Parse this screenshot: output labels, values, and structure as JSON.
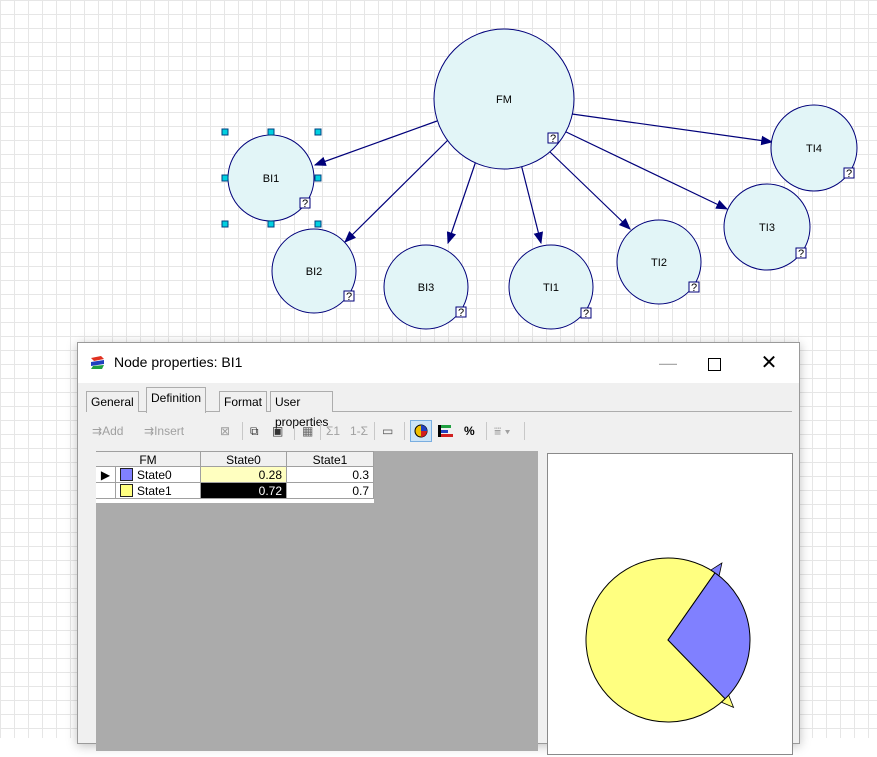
{
  "network": {
    "nodes": [
      "FM",
      "BI1",
      "BI2",
      "BI3",
      "TI1",
      "TI2",
      "TI3",
      "TI4"
    ],
    "badge": "?"
  },
  "dialog": {
    "title": "Node properties: BI1",
    "tabs": [
      "General",
      "Definition",
      "Format",
      "User properties"
    ],
    "active_tab": "Definition",
    "toolbar": {
      "add": "Add",
      "insert": "Insert",
      "sum1": "Σ1",
      "one_sigma": "1-Σ",
      "percent": "%"
    },
    "grid": {
      "corner_header": "FM",
      "columns": [
        "State0",
        "State1"
      ],
      "rows": [
        {
          "label": "State0",
          "color": "#8080ff",
          "values": [
            "0.28",
            "0.3"
          ]
        },
        {
          "label": "State1",
          "color": "#ffff80",
          "values": [
            "0.72",
            "0.7"
          ]
        }
      ]
    },
    "pie": {
      "slices": [
        {
          "label": "State0",
          "value": 0.28,
          "color": "#8080ff"
        },
        {
          "label": "State1",
          "value": 0.72,
          "color": "#ffff80"
        }
      ]
    }
  }
}
